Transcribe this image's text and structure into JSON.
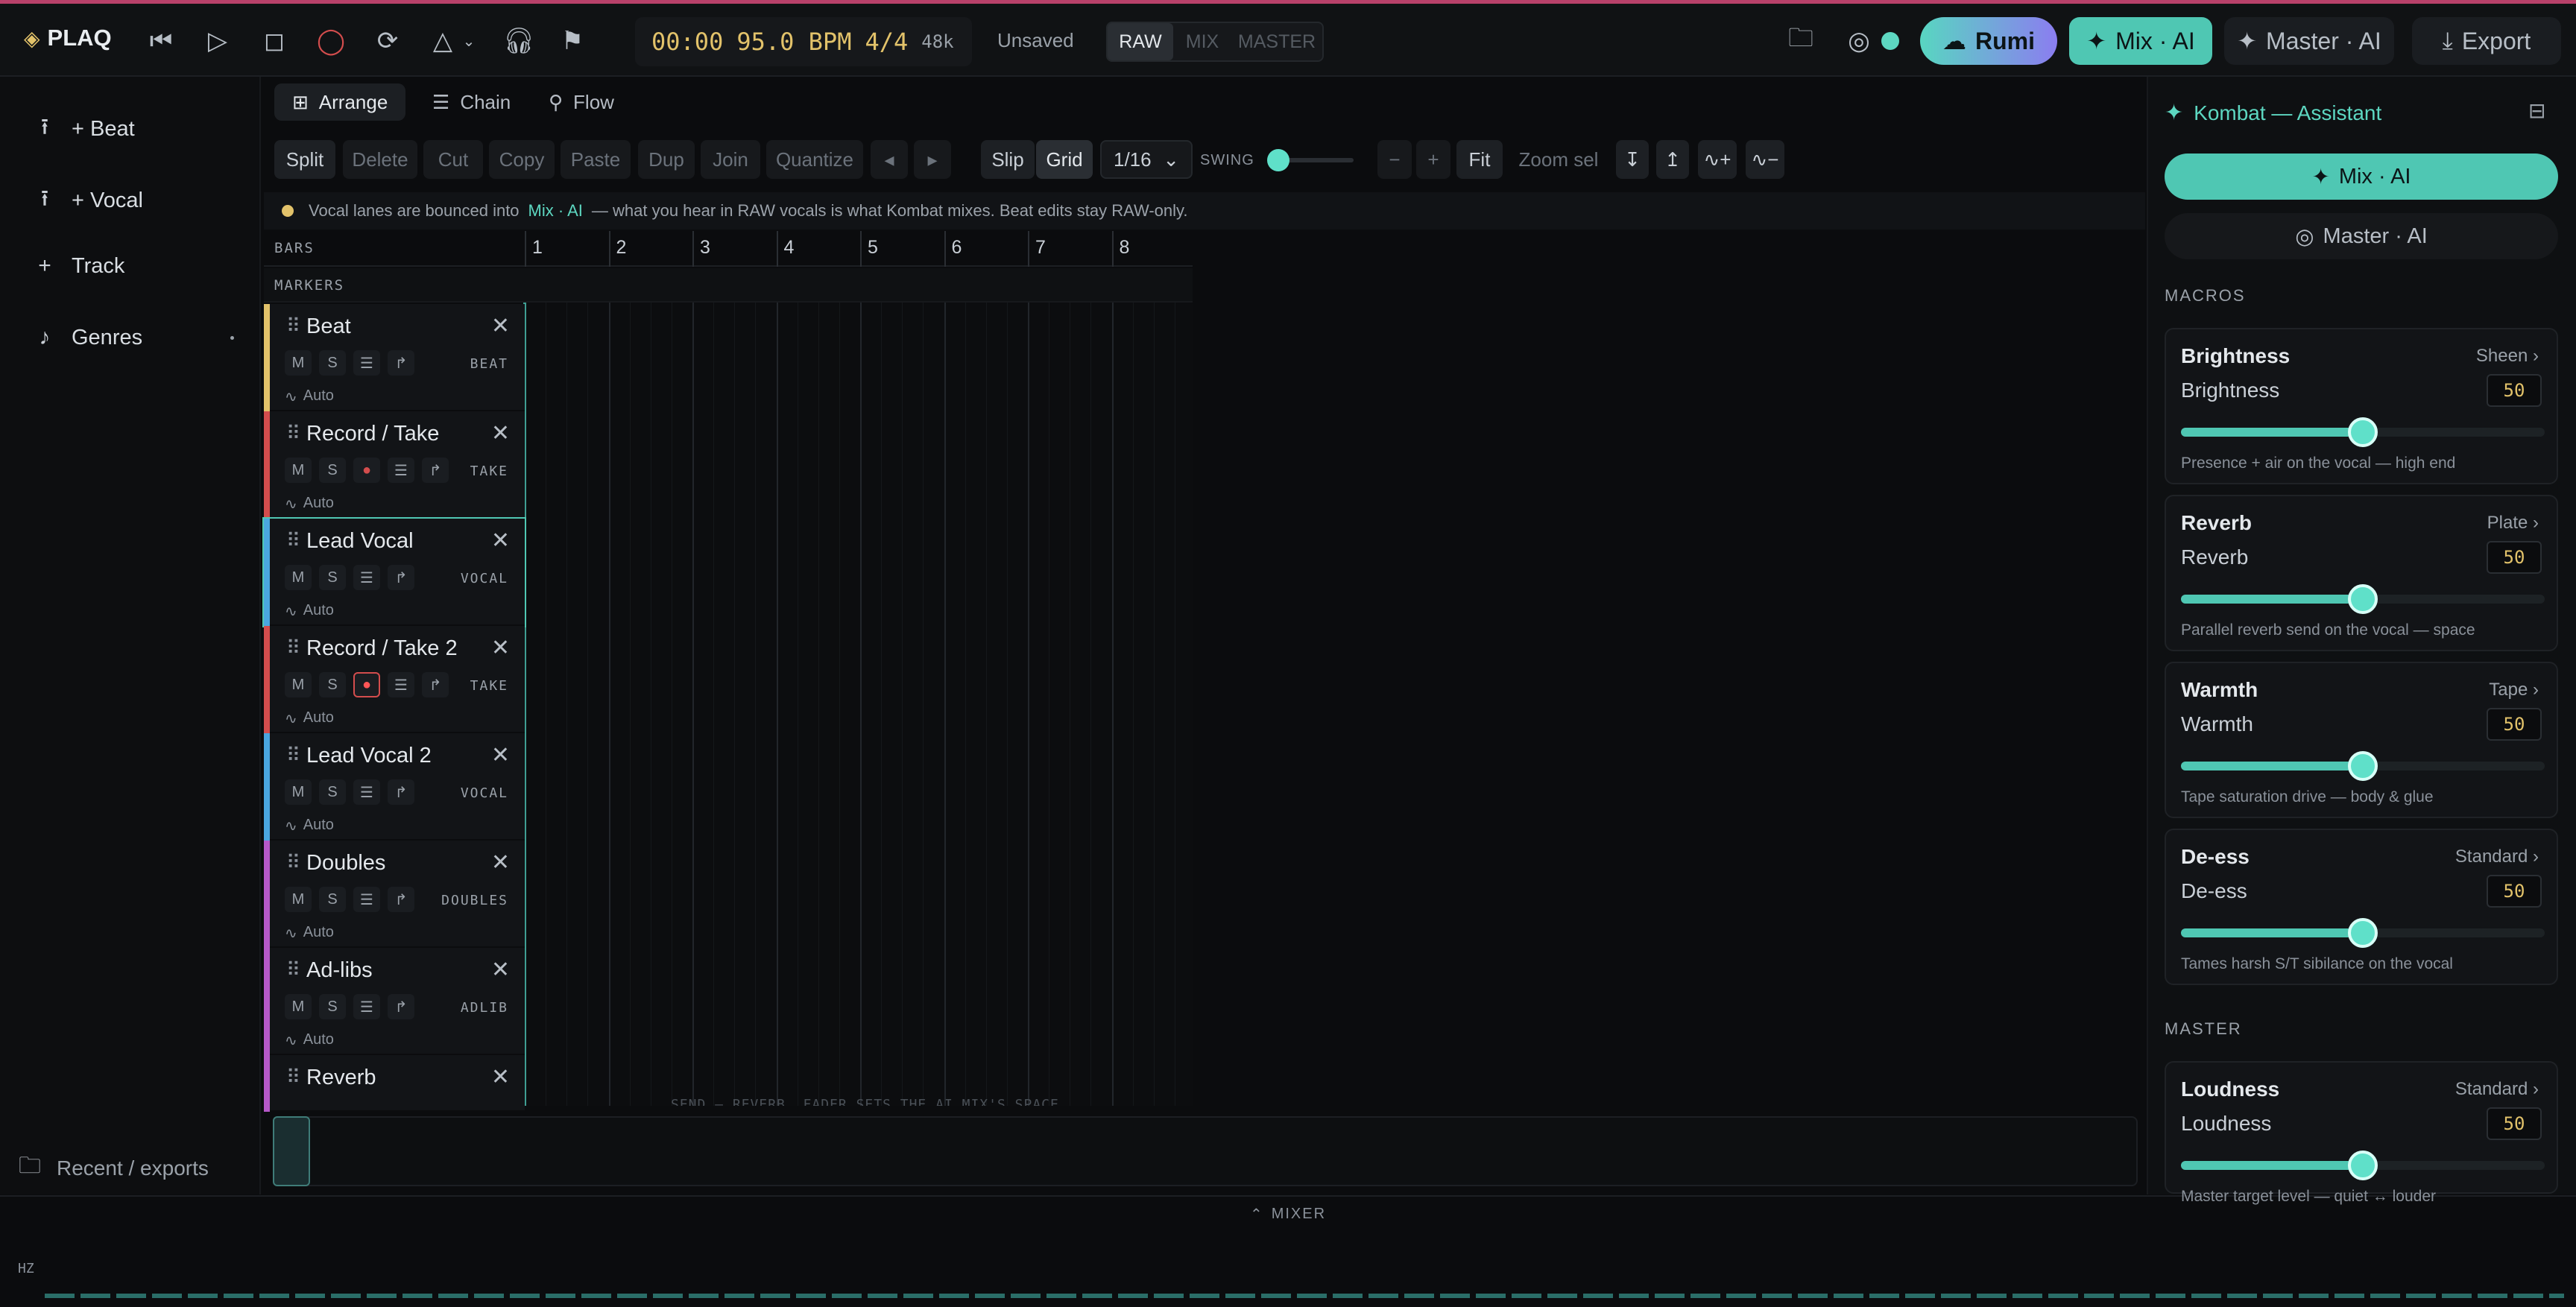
{
  "app": {
    "logo": "PLAQ",
    "logo_glyph": "◈"
  },
  "transport": {
    "time": "00:00",
    "bpm": "95.0 BPM",
    "signature": "4/4",
    "rate": "48k",
    "status": "Unsaved",
    "modes": [
      "RAW",
      "MIX",
      "MASTER"
    ]
  },
  "top_right": {
    "rumi": "Rumi",
    "mix_ai": "Mix · AI",
    "master_ai": "Master · AI",
    "export": "Export"
  },
  "sidebar": {
    "items": [
      {
        "icon": "⭱",
        "label": "+ Beat"
      },
      {
        "icon": "⭱",
        "label": "+ Vocal"
      },
      {
        "icon": "+",
        "label": "Track"
      },
      {
        "icon": "♪",
        "label": "Genres"
      }
    ],
    "footer": "Recent / exports"
  },
  "view_tabs": [
    "Arrange",
    "Chain",
    "Flow"
  ],
  "toolbar": {
    "left": [
      "Split",
      "Delete",
      "Cut",
      "Copy",
      "Paste",
      "Dup",
      "Join",
      "Quantize"
    ],
    "prev": "◂",
    "next": "▸",
    "slip": "Slip",
    "grid": "Grid",
    "division": "1/16",
    "swing": "SWING",
    "swing_level": 0,
    "zoom_minus": "−",
    "zoom_plus": "+",
    "fit": "Fit",
    "zoom_sel": "Zoom sel",
    "extra": [
      "↧",
      "↥",
      "∿+",
      "∿−"
    ]
  },
  "notice": {
    "text_a": "Vocal lanes are bounced into",
    "highlight": "Mix · AI",
    "text_b": "— what you hear in RAW vocals is what Kombat mixes. Beat edits stay RAW-only."
  },
  "ruler": {
    "bars_label": "BARS",
    "markers_label": "MARKERS",
    "bars": [
      "1",
      "2",
      "3",
      "4",
      "5",
      "6",
      "7",
      "8"
    ]
  },
  "tracks": [
    {
      "name": "Beat",
      "tag": "BEAT",
      "color": "#e2c26a",
      "rec": false,
      "recon": false
    },
    {
      "name": "Record / Take",
      "tag": "TAKE",
      "color": "#d34d4d",
      "rec": true,
      "recon": false
    },
    {
      "name": "Lead Vocal",
      "tag": "VOCAL",
      "color": "#4aa6e0",
      "rec": false,
      "recon": false,
      "selected": true
    },
    {
      "name": "Record / Take 2",
      "tag": "TAKE",
      "color": "#d34d4d",
      "rec": true,
      "recon": true
    },
    {
      "name": "Lead Vocal 2",
      "tag": "VOCAL",
      "color": "#4aa6e0",
      "rec": false,
      "recon": false
    },
    {
      "name": "Doubles",
      "tag": "DOUBLES",
      "color": "#b658c8",
      "rec": false,
      "recon": false
    },
    {
      "name": "Ad-libs",
      "tag": "ADLIB",
      "color": "#b658c8",
      "rec": false,
      "recon": false
    },
    {
      "name": "Reverb",
      "tag": "",
      "color": "#b658c8",
      "rec": false,
      "recon": false
    }
  ],
  "track_buttons": {
    "mute": "M",
    "solo": "S",
    "auto": "Auto"
  },
  "reverb_hint": "SEND — REVERB. FADER SETS THE AI MIX'S SPACE",
  "mixer": {
    "label": "MIXER",
    "hz": "HZ"
  },
  "assistant": {
    "title": "Kombat — Assistant",
    "mix_button": "Mix · AI",
    "master_button": "Master · AI",
    "macros_label": "MACROS",
    "master_label": "MASTER",
    "macros": [
      {
        "title": "Brightness",
        "preset": "Sheen",
        "label": "Brightness",
        "value": 50,
        "desc": "Presence + air on the vocal — high end"
      },
      {
        "title": "Reverb",
        "preset": "Plate",
        "label": "Reverb",
        "value": 50,
        "desc": "Parallel reverb send on the vocal — space"
      },
      {
        "title": "Warmth",
        "preset": "Tape",
        "label": "Warmth",
        "value": 50,
        "desc": "Tape saturation drive — body & glue"
      },
      {
        "title": "De-ess",
        "preset": "Standard",
        "label": "De-ess",
        "value": 50,
        "desc": "Tames harsh S/T sibilance on the vocal"
      }
    ],
    "master": {
      "title": "Loudness",
      "preset": "Standard",
      "label": "Loudness",
      "value": 50,
      "desc": "Master target level — quiet ↔ louder"
    }
  },
  "colors": {
    "accent": "#4fc7b3",
    "record": "#d34d4d",
    "time": "#e2c26a"
  }
}
